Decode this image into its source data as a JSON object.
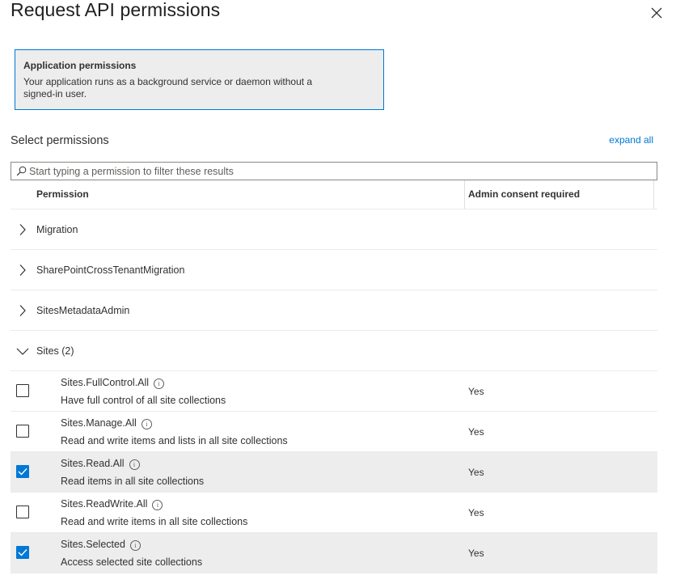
{
  "panel": {
    "title": "Request API permissions",
    "info_box": {
      "title": "Application permissions",
      "description": "Your application runs as a background service or daemon without a signed-in user."
    },
    "select_label": "Select permissions",
    "expand_all": "expand all",
    "search": {
      "placeholder": "Start typing a permission to filter these results",
      "value": ""
    }
  },
  "table": {
    "columns": {
      "permission": "Permission",
      "admin_consent": "Admin consent required"
    },
    "groups": [
      {
        "label": "Migration",
        "expanded": false
      },
      {
        "label": "SharePointCrossTenantMigration",
        "expanded": false
      },
      {
        "label": "SitesMetadataAdmin",
        "expanded": false
      },
      {
        "label": "Sites (2)",
        "expanded": true
      }
    ],
    "permissions": [
      {
        "name": "Sites.FullControl.All",
        "description": "Have full control of all site collections",
        "admin": "Yes",
        "checked": false
      },
      {
        "name": "Sites.Manage.All",
        "description": "Read and write items and lists in all site collections",
        "admin": "Yes",
        "checked": false
      },
      {
        "name": "Sites.Read.All",
        "description": "Read items in all site collections",
        "admin": "Yes",
        "checked": true
      },
      {
        "name": "Sites.ReadWrite.All",
        "description": "Read and write items in all site collections",
        "admin": "Yes",
        "checked": false
      },
      {
        "name": "Sites.Selected",
        "description": "Access selected site collections",
        "admin": "Yes",
        "checked": true
      }
    ]
  },
  "colors": {
    "accent": "#0078d4",
    "selected_row": "#ededed"
  }
}
